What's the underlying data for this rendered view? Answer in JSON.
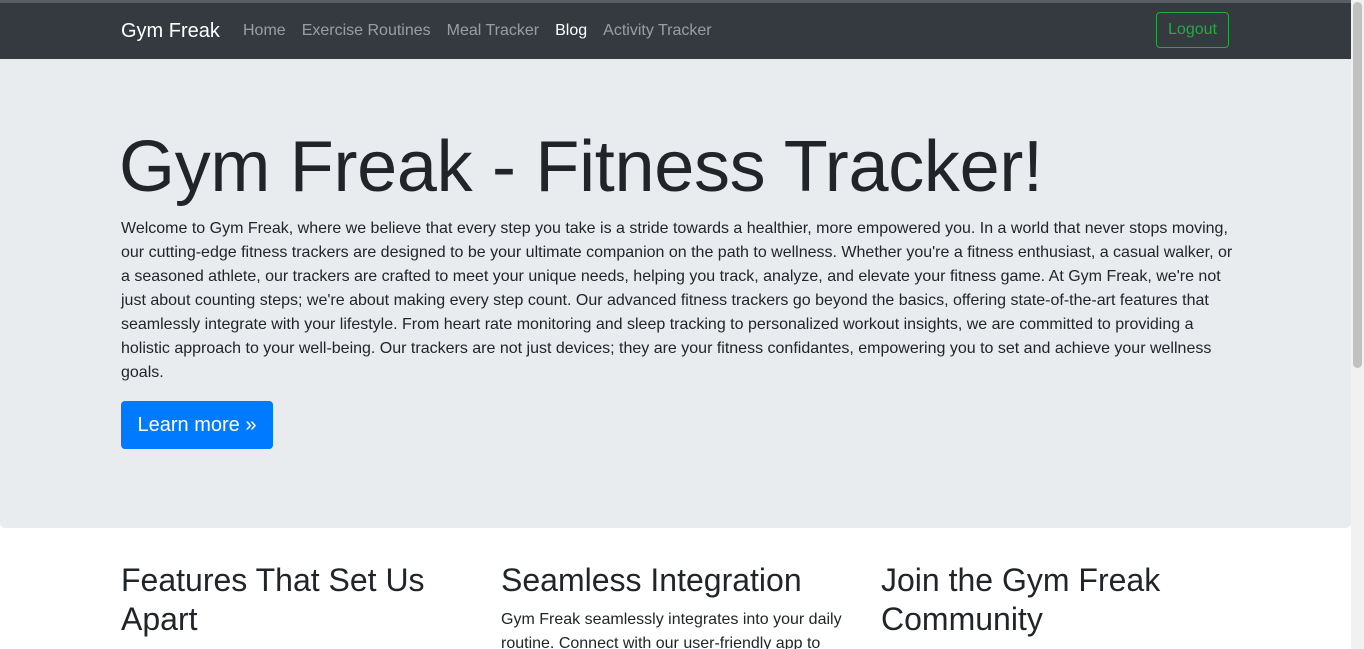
{
  "navbar": {
    "brand": "Gym Freak",
    "links": [
      {
        "label": "Home",
        "active": false
      },
      {
        "label": "Exercise Routines",
        "active": false
      },
      {
        "label": "Meal Tracker",
        "active": false
      },
      {
        "label": "Blog",
        "active": true
      },
      {
        "label": "Activity Tracker",
        "active": false
      }
    ],
    "logout_label": "Logout"
  },
  "jumbotron": {
    "title": "Gym Freak - Fitness Tracker!",
    "text": "Welcome to Gym Freak, where we believe that every step you take is a stride towards a healthier, more empowered you. In a world that never stops moving, our cutting-edge fitness trackers are designed to be your ultimate companion on the path to wellness. Whether you're a fitness enthusiast, a casual walker, or a seasoned athlete, our trackers are crafted to meet your unique needs, helping you track, analyze, and elevate your fitness game. At Gym Freak, we're not just about counting steps; we're about making every step count. Our advanced fitness trackers go beyond the basics, offering state-of-the-art features that seamlessly integrate with your lifestyle. From heart rate monitoring and sleep tracking to personalized workout insights, we are committed to providing a holistic approach to your well-being. Our trackers are not just devices; they are your fitness confidantes, empowering you to set and achieve your wellness goals.",
    "button_label": "Learn more »"
  },
  "columns": [
    {
      "heading": "Features That Set Us Apart",
      "text": ""
    },
    {
      "heading": "Seamless Integration",
      "text": "Gym Freak seamlessly integrates into your daily routine. Connect with our user-friendly app to"
    },
    {
      "heading": "Join the Gym Freak Community",
      "text": ""
    }
  ],
  "colors": {
    "navbar_bg": "#343a40",
    "jumbotron_bg": "#e9ecef",
    "primary": "#007bff",
    "success": "#28a745"
  }
}
